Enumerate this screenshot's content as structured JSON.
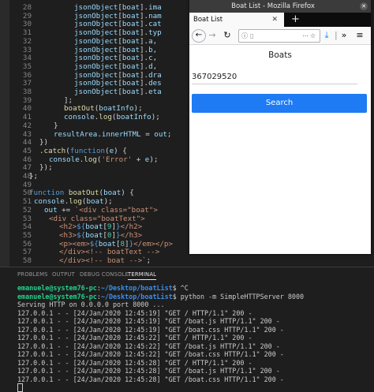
{
  "editor": {
    "lines": [
      {
        "num": "28",
        "html": "<span class=\"v\">jsonObject</span>[<span class=\"v\">boat</span>].<span class=\"v\">ima</span>"
      },
      {
        "num": "29",
        "html": "<span class=\"v\">jsonObject</span>[<span class=\"v\">boat</span>].<span class=\"v\">nam</span>"
      },
      {
        "num": "30",
        "html": "<span class=\"v\">jsonObject</span>[<span class=\"v\">boat</span>].<span class=\"v\">cat</span>"
      },
      {
        "num": "31",
        "html": "<span class=\"v\">jsonObject</span>[<span class=\"v\">boat</span>].<span class=\"v\">typ</span>"
      },
      {
        "num": "32",
        "html": "<span class=\"v\">jsonObject</span>[<span class=\"v\">boat</span>].<span class=\"v\">a</span>,"
      },
      {
        "num": "33",
        "html": "<span class=\"v\">jsonObject</span>[<span class=\"v\">boat</span>].<span class=\"v\">b</span>,"
      },
      {
        "num": "34",
        "html": "<span class=\"v\">jsonObject</span>[<span class=\"v\">boat</span>].<span class=\"v\">c</span>,"
      },
      {
        "num": "35",
        "html": "<span class=\"v\">jsonObject</span>[<span class=\"v\">boat</span>].<span class=\"v\">d</span>,"
      },
      {
        "num": "36",
        "html": "<span class=\"v\">jsonObject</span>[<span class=\"v\">boat</span>].<span class=\"v\">dra</span>"
      },
      {
        "num": "37",
        "html": "<span class=\"v\">jsonObject</span>[<span class=\"v\">boat</span>].<span class=\"v\">des</span>"
      },
      {
        "num": "38",
        "html": "<span class=\"v\">jsonObject</span>[<span class=\"v\">boat</span>].<span class=\"v\">eta</span>"
      },
      {
        "num": "39",
        "html": "];"
      },
      {
        "num": "40",
        "html": "<span class=\"f\">boatOut</span>(<span class=\"v\">boatInfo</span>);"
      },
      {
        "num": "41",
        "html": "<span class=\"v\">console</span>.<span class=\"f\">log</span>(<span class=\"v\">boatInfo</span>);"
      },
      {
        "num": "42",
        "html": "}"
      },
      {
        "num": "43",
        "html": "<span class=\"v\">resultArea</span>.<span class=\"v\">innerHTML</span> = <span class=\"v\">out</span>;"
      },
      {
        "num": "44",
        "html": "})"
      },
      {
        "num": "45",
        "html": ".<span class=\"f\">catch</span>(<span class=\"k\">function</span>(<span class=\"v\">e</span>) {"
      },
      {
        "num": "46",
        "html": "<span class=\"v\">console</span>.<span class=\"f\">log</span>(<span class=\"s\">'Error'</span> + <span class=\"v\">e</span>);"
      },
      {
        "num": "47",
        "html": "});"
      },
      {
        "num": "48",
        "html": "};"
      },
      {
        "num": "49",
        "html": ""
      },
      {
        "num": "50",
        "html": "<span class=\"k\">function</span> <span class=\"f\">boatOut</span>(<span class=\"v\">boat</span>) {"
      },
      {
        "num": "51",
        "html": "<span class=\"v\">console</span>.<span class=\"f\">log</span>(<span class=\"v\">boat</span>);"
      },
      {
        "num": "52",
        "html": "<span class=\"v\">out</span> += <span class=\"s\">`&lt;div class=\"boat\"&gt;</span>"
      },
      {
        "num": "53",
        "html": "<span class=\"s\">&lt;div class=\"boatText\"&gt;</span>"
      },
      {
        "num": "54",
        "html": "<span class=\"s\">&lt;h2&gt;</span><span class=\"k\">${</span><span class=\"v\">boat</span>[<span class=\"t\">9</span>]<span class=\"k\">}</span><span class=\"s\">&lt;/h2&gt;</span>"
      },
      {
        "num": "55",
        "html": "<span class=\"s\">&lt;h3&gt;</span><span class=\"k\">${</span><span class=\"v\">boat</span>[<span class=\"t\">0</span>]<span class=\"k\">}</span><span class=\"s\">&lt;/h3&gt;</span>"
      },
      {
        "num": "56",
        "html": "<span class=\"s\">&lt;p&gt;&lt;em&gt;</span><span class=\"k\">${</span><span class=\"v\">boat</span>[<span class=\"t\">8</span>]<span class=\"k\">}</span><span class=\"s\">&lt;/em&gt;&lt;/p&gt;</span>"
      },
      {
        "num": "57",
        "html": "<span class=\"s\">&lt;/div&gt;&lt;!-- boatText --&gt;</span>"
      },
      {
        "num": "58",
        "html": "<span class=\"s\">&lt;/div&gt;&lt;!-- boat --&gt;`</span>;"
      }
    ]
  },
  "panel": {
    "tabs": [
      "PROBLEMS",
      "OUTPUT",
      "DEBUG CONSOLE",
      "TERMINAL"
    ],
    "active_tab": "TERMINAL",
    "terminal": {
      "prompt_user": "emanuele@system76-pc",
      "prompt_path": "~/Desktop/boatList",
      "cmd1": "^C",
      "cmd2": "python -m SimpleHTTPServer 8000",
      "serving": "Serving HTTP on 0.0.0.0 port 8000 ...",
      "log": [
        "127.0.0.1 - - [24/Jan/2020 12:45:19] \"GET / HTTP/1.1\" 200 -",
        "127.0.0.1 - - [24/Jan/2020 12:45:19] \"GET /boat.js HTTP/1.1\" 200 -",
        "127.0.0.1 - - [24/Jan/2020 12:45:19] \"GET /boat.css HTTP/1.1\" 200 -",
        "127.0.0.1 - - [24/Jan/2020 12:45:22] \"GET / HTTP/1.1\" 200 -",
        "127.0.0.1 - - [24/Jan/2020 12:45:22] \"GET /boat.js HTTP/1.1\" 200 -",
        "127.0.0.1 - - [24/Jan/2020 12:45:22] \"GET /boat.css HTTP/1.1\" 200 -",
        "127.0.0.1 - - [24/Jan/2020 12:45:28] \"GET / HTTP/1.1\" 200 -",
        "127.0.0.1 - - [24/Jan/2020 12:45:28] \"GET /boat.js HTTP/1.1\" 200 -",
        "127.0.0.1 - - [24/Jan/2020 12:45:28] \"GET /boat.css HTTP/1.1\" 200 -"
      ]
    }
  },
  "firefox": {
    "window_title": "Boat List - Mozilla Firefox",
    "tab_label": "Boat List",
    "page": {
      "heading": "Boats",
      "input_value": "367029520",
      "button_label": "Search"
    }
  },
  "colors": {
    "accent_button": "#1e7bf4",
    "prompt_green": "#23d18b",
    "path_blue": "#3b8eea"
  },
  "icons": [
    "close-icon",
    "plus-icon",
    "back-icon",
    "forward-icon",
    "reload-icon",
    "info-icon",
    "bookmark-star-icon",
    "download-icon",
    "overflow-icon",
    "menu-icon"
  ]
}
